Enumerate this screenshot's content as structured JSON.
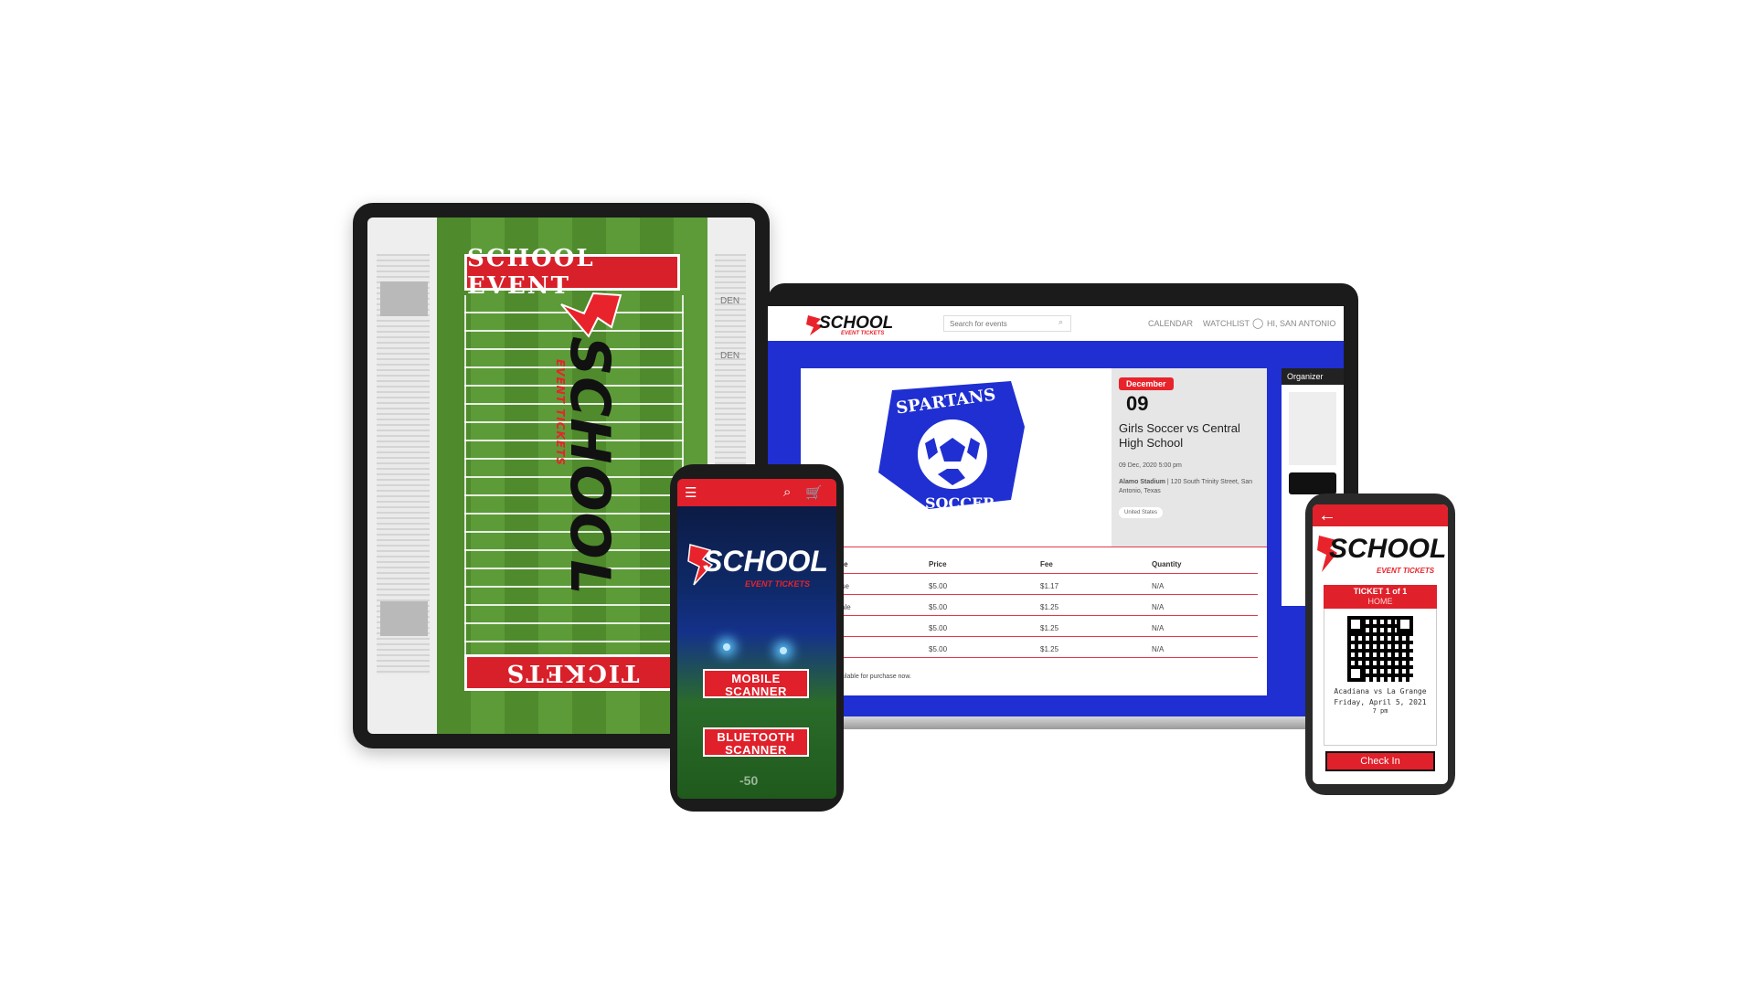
{
  "tablet": {
    "endzone_top": "SCHOOL EVENT",
    "endzone_bottom": "TICKETS",
    "logo_main": "SCHOOL",
    "logo_sub": "EVENT TICKETS",
    "side_label_1": "DEN",
    "side_label_2": "DEN"
  },
  "laptop": {
    "logo_main": "SCHOOL",
    "logo_sub": "EVENT TICKETS",
    "search_placeholder": "Search for events",
    "nav": [
      "CALENDAR",
      "WATCHLIST",
      "HI, SAN ANTONIO"
    ],
    "team_banner": "SPARTANS",
    "team_sub": "SOCCER",
    "event": {
      "month": "December",
      "day": "09",
      "title": "Girls Soccer vs Central High School",
      "datetime": "09 Dec, 2020 5:00 pm",
      "venue": "Alamo Stadium",
      "address": "| 120 South Trinity Street, San Antonio, Texas",
      "country": "United States"
    },
    "organizer_label": "Organizer",
    "table": {
      "headers": [
        "me",
        "Price",
        "Fee",
        "Quantity"
      ],
      "rows": [
        [
          "ase",
          "$5.00",
          "$1.17",
          "N/A"
        ],
        [
          "sale",
          "$5.00",
          "$1.25",
          "N/A"
        ],
        [
          "",
          "$5.00",
          "$1.25",
          "N/A"
        ],
        [
          "",
          "$5.00",
          "$1.25",
          "N/A"
        ]
      ],
      "note": "vailable for purchase now."
    }
  },
  "phone1": {
    "logo_main": "SCHOOL",
    "logo_sub": "EVENT TICKETS",
    "btn_mobile": "MOBILE SCANNER",
    "btn_bluetooth": "BLUETOOTH SCANNER",
    "yard": "-50"
  },
  "phone2": {
    "logo_main": "SCHOOL",
    "logo_sub": "EVENT TICKETS",
    "ticket_label": "TICKET 1 of 1",
    "ticket_type": "HOME",
    "game": "Acadiana vs La Grange",
    "date": "Friday, April 5, 2021",
    "time": "7 pm",
    "checkin": "Check In"
  },
  "colors": {
    "brand_red": "#e8232b",
    "brand_blue": "#1f2fd1",
    "field_green": "#4f8a2d"
  }
}
